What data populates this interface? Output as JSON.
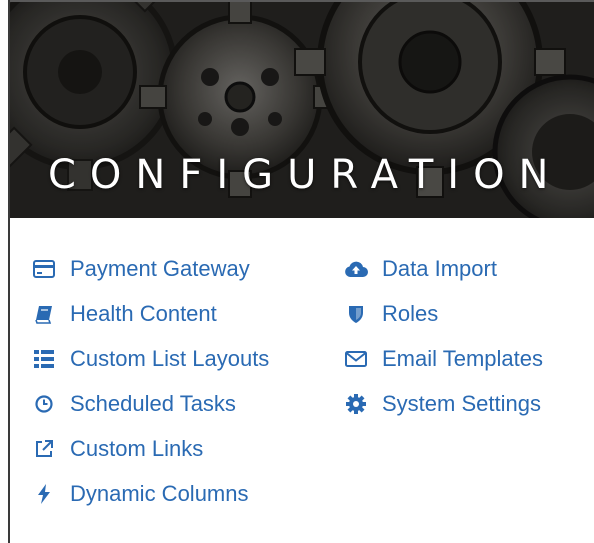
{
  "header": {
    "title": "CONFIGURATION"
  },
  "links": {
    "left": [
      {
        "label": "Payment Gateway",
        "icon": "credit-card-icon"
      },
      {
        "label": "Health Content",
        "icon": "book-icon"
      },
      {
        "label": "Custom List Layouts",
        "icon": "list-icon"
      },
      {
        "label": "Scheduled Tasks",
        "icon": "clock-icon"
      },
      {
        "label": "Custom Links",
        "icon": "external-link-icon"
      },
      {
        "label": "Dynamic Columns",
        "icon": "bolt-icon"
      }
    ],
    "right": [
      {
        "label": "Data Import",
        "icon": "cloud-upload-icon"
      },
      {
        "label": "Roles",
        "icon": "shield-icon"
      },
      {
        "label": "Email Templates",
        "icon": "envelope-icon"
      },
      {
        "label": "System Settings",
        "icon": "gear-icon"
      }
    ]
  },
  "colors": {
    "link": "#2a6ab3",
    "hero_text": "#ffffff"
  }
}
